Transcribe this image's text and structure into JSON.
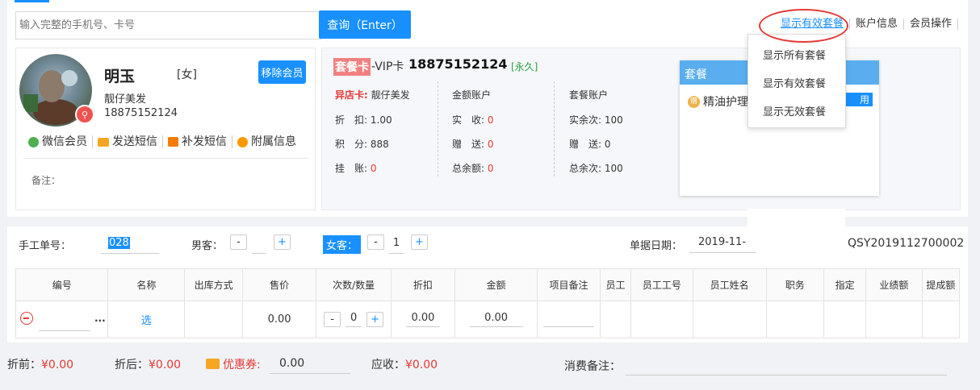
{
  "search": {
    "placeholder": "输入完整的手机号、卡号",
    "button": "查询（Enter）"
  },
  "toplinks": {
    "show_valid": "显示有效套餐",
    "account": "账户信息",
    "member_ops": "会员操作"
  },
  "dropdown": {
    "items": [
      "显示所有套餐",
      "显示有效套餐",
      "显示无效套餐"
    ]
  },
  "member": {
    "name": "明玉",
    "gender": "[女]",
    "store": "靓仔美发",
    "phone": "18875152124",
    "remove_button": "移除会员",
    "actions": [
      "微信会员",
      "发送短信",
      "补发短信",
      "附属信息"
    ],
    "note_label": "备注："
  },
  "card": {
    "tag": "套餐卡",
    "type": "-VIP卡",
    "number": "18875152124",
    "validity": "[永久]",
    "other_store_label": "异店卡:",
    "other_store_value": "靓仔美发",
    "discount_label": "折　扣:",
    "discount_value": "1.00",
    "points_label": "积　分:",
    "points_value": "888",
    "credit_label": "挂　账:",
    "credit_value": "0",
    "amount_title": "金额账户",
    "received_label": "实　收:",
    "received_value": "0",
    "gift_label": "赠　送:",
    "gift_value": "0",
    "total_balance_label": "总余额:",
    "total_balance_value": "0",
    "package_title": "套餐账户",
    "actual_times_label": "实余次:",
    "actual_times_value": "100",
    "gift_times_label": "赠　送:",
    "gift_times_value": "0",
    "total_times_label": "总余次:",
    "total_times_value": "100"
  },
  "package_panel": {
    "title": "套餐",
    "item": "精油护理",
    "item_icon": "赠",
    "use_button": "用"
  },
  "order": {
    "manual_no_label": "手工单号：",
    "manual_no_value": "028",
    "male_label": "男客：",
    "male_count": "",
    "female_label": "女客：",
    "female_count": "1",
    "date_label": "单据日期：",
    "date_value": "2019-11-",
    "order_no": "QSY2019112700002"
  },
  "table": {
    "headers": [
      "编号",
      "名称",
      "出库方式",
      "售价",
      "次数/数量",
      "折扣",
      "金额",
      "项目备注",
      "员工",
      "员工工号",
      "员工姓名",
      "职务",
      "指定",
      "业绩额",
      "提成额"
    ],
    "row": {
      "more": "...",
      "select": "选",
      "price": "0.00",
      "qty": "0",
      "discount": "0.00",
      "amount": "0.00"
    }
  },
  "footer": {
    "before_label": "折前：",
    "before_value": "¥0.00",
    "after_label": "折后：",
    "after_value": "¥0.00",
    "coupon_label": "优惠券:",
    "coupon_value": "0.00",
    "receivable_label": "应收：",
    "receivable_value": "¥0.00",
    "remark_label": "消费备注："
  },
  "colors": {
    "accent": "#1890ff",
    "danger": "#e53935",
    "success": "#2e9e41",
    "card_tag": "#f08080"
  }
}
